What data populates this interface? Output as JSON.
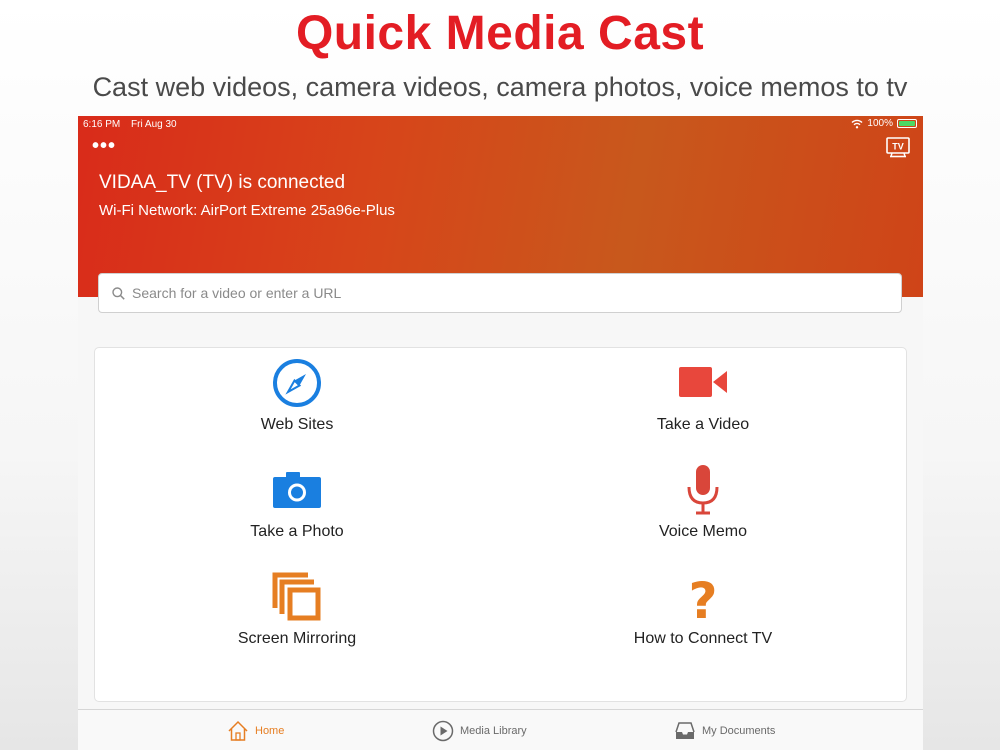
{
  "promo": {
    "title": "Quick Media Cast",
    "subtitle": "Cast web videos,  camera videos, camera photos, voice memos to tv"
  },
  "status_bar": {
    "time": "6:16 PM",
    "date": "Fri Aug 30",
    "battery": "100%"
  },
  "header": {
    "menu_icon": "more-dots-icon",
    "tv_button_label": "TV",
    "connected_text": "VIDAA_TV (TV) is connected",
    "network_text": "Wi-Fi Network: AirPort Extreme 25a96e-Plus"
  },
  "search": {
    "placeholder": "Search for a video or enter a URL",
    "value": ""
  },
  "actions": [
    {
      "label": "Web Sites",
      "icon": "compass-icon",
      "color": "#1a7fe0"
    },
    {
      "label": "Take a Video",
      "icon": "video-camera-icon",
      "color": "#e8473c"
    },
    {
      "label": "Take a Photo",
      "icon": "camera-icon",
      "color": "#1a7fe0"
    },
    {
      "label": "Voice Memo",
      "icon": "microphone-icon",
      "color": "#d9463a"
    },
    {
      "label": "Screen Mirroring",
      "icon": "mirror-icon",
      "color": "#e67e22"
    },
    {
      "label": "How to Connect TV",
      "icon": "question-icon",
      "color": "#e67e22"
    }
  ],
  "tabs": [
    {
      "label": "Home",
      "icon": "home-icon",
      "active": true
    },
    {
      "label": "Media Library",
      "icon": "play-icon",
      "active": false
    },
    {
      "label": "My Documents",
      "icon": "inbox-icon",
      "active": false
    }
  ],
  "colors": {
    "brand_red": "#e31d24",
    "header_orange": "#d7451a",
    "tab_active": "#e67e22"
  }
}
